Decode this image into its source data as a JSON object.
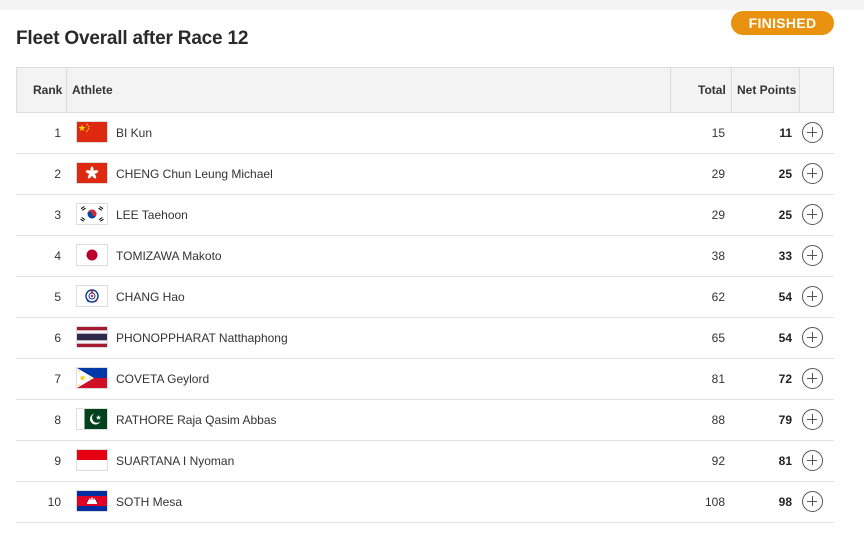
{
  "page": {
    "title": "Fleet Overall after Race 12",
    "status": "FINISHED"
  },
  "table": {
    "headers": {
      "rank": "Rank",
      "athlete": "Athlete",
      "total": "Total",
      "net": "Net Points"
    },
    "rows": [
      {
        "rank": "1",
        "flag": "china-flag",
        "name": "BI Kun",
        "total": "15",
        "net": "11"
      },
      {
        "rank": "2",
        "flag": "hong-kong-flag",
        "name": "CHENG Chun Leung Michael",
        "total": "29",
        "net": "25"
      },
      {
        "rank": "3",
        "flag": "korea-flag",
        "name": "LEE Taehoon",
        "total": "29",
        "net": "25"
      },
      {
        "rank": "4",
        "flag": "japan-flag",
        "name": "TOMIZAWA Makoto",
        "total": "38",
        "net": "33"
      },
      {
        "rank": "5",
        "flag": "chinese-taipei-flag",
        "name": "CHANG Hao",
        "total": "62",
        "net": "54"
      },
      {
        "rank": "6",
        "flag": "thailand-flag",
        "name": "PHONOPPHARAT Natthaphong",
        "total": "65",
        "net": "54"
      },
      {
        "rank": "7",
        "flag": "philippines-flag",
        "name": "COVETA Geylord",
        "total": "81",
        "net": "72"
      },
      {
        "rank": "8",
        "flag": "pakistan-flag",
        "name": "RATHORE Raja Qasim Abbas",
        "total": "88",
        "net": "79"
      },
      {
        "rank": "9",
        "flag": "indonesia-flag",
        "name": "SUARTANA I Nyoman",
        "total": "92",
        "net": "81"
      },
      {
        "rank": "10",
        "flag": "cambodia-flag",
        "name": "SOTH Mesa",
        "total": "108",
        "net": "98"
      }
    ]
  },
  "colors": {
    "accent": "#e8920f",
    "header_bg": "#f3f3f3"
  }
}
